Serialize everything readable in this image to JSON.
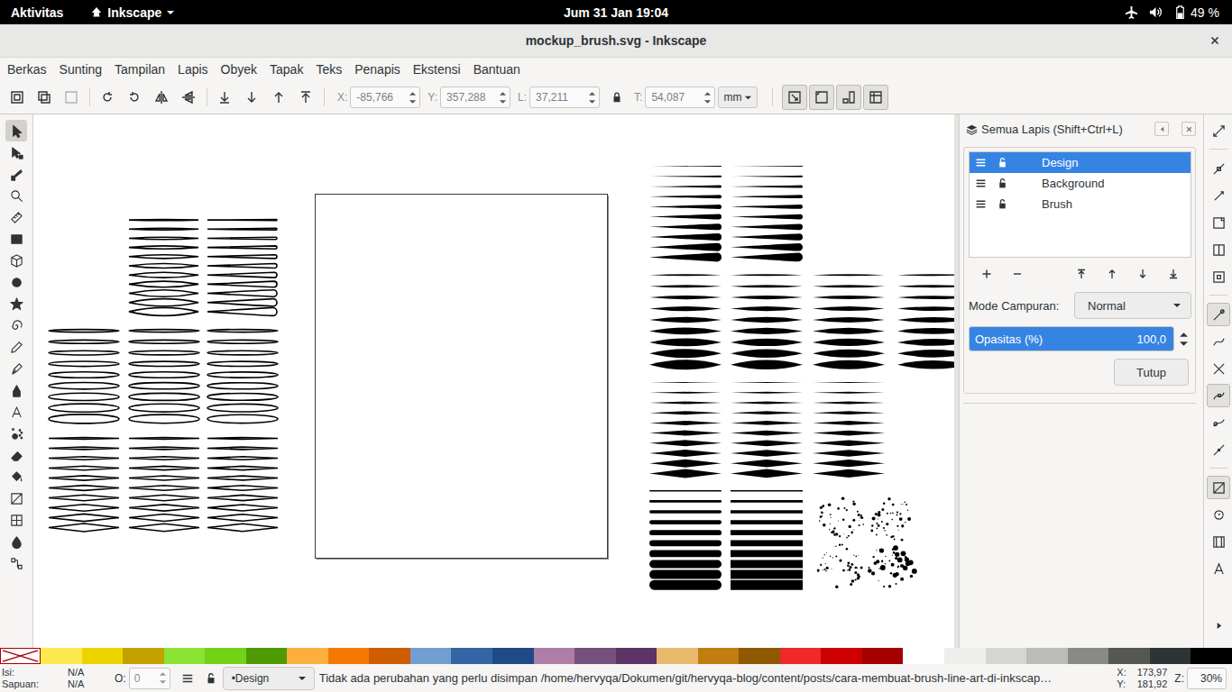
{
  "top_bar": {
    "activities": "Aktivitas",
    "app_name": "Inkscape",
    "clock": "Jum 31 Jan 19:04",
    "battery": "49 %"
  },
  "window": {
    "title": "mockup_brush.svg - Inkscape"
  },
  "menu": [
    "Berkas",
    "Sunting",
    "Tampilan",
    "Lapis",
    "Obyek",
    "Tapak",
    "Teks",
    "Penapis",
    "Ekstensi",
    "Bantuan"
  ],
  "tool_controls": {
    "actions": [
      {
        "disabled": false
      },
      {
        "disabled": false
      },
      {
        "disabled": true
      },
      {
        "disabled": false
      },
      {
        "disabled": false
      },
      {
        "disabled": false
      },
      {
        "disabled": false
      },
      {
        "disabled": false
      },
      {
        "disabled": false
      },
      {
        "disabled": false
      },
      {
        "disabled": false
      }
    ],
    "fields": [
      {
        "label": "X:",
        "value": "-85,766",
        "disabled": true
      },
      {
        "label": "Y:",
        "value": "357,288",
        "disabled": true
      },
      {
        "label": "L:",
        "value": "37,211",
        "disabled": true
      },
      {
        "label": "T:",
        "value": "54,087",
        "disabled": true
      }
    ],
    "unit": "mm",
    "toggles": [
      {
        "on": true
      },
      {
        "on": true
      },
      {
        "on": true
      },
      {
        "on": true
      }
    ]
  },
  "tools": [
    {
      "selected": true
    },
    {
      "selected": false
    },
    {
      "selected": false
    },
    {
      "selected": false
    },
    {
      "selected": false
    },
    {
      "selected": false
    },
    {
      "selected": false
    },
    {
      "selected": false
    },
    {
      "selected": false
    },
    {
      "selected": false
    },
    {
      "selected": false
    },
    {
      "selected": false
    },
    {
      "selected": false
    },
    {
      "selected": false
    },
    {
      "selected": false
    },
    {
      "selected": false
    },
    {
      "selected": false
    },
    {
      "selected": false
    },
    {
      "selected": false
    },
    {
      "selected": false
    },
    {
      "selected": false
    }
  ],
  "layers_panel": {
    "title": "Semua Lapis (Shift+Ctrl+L)",
    "layers": [
      {
        "name": "Design",
        "selected": true,
        "locked": false
      },
      {
        "name": "Background",
        "selected": false,
        "locked": false
      },
      {
        "name": "Brush",
        "selected": false,
        "locked": false
      }
    ],
    "blend_label": "Mode Campuran:",
    "blend_value": "Normal",
    "opacity_label": "Opasitas (%)",
    "opacity_value": "100,0",
    "opacity_level": 1.0,
    "close_button": "Tutup"
  },
  "snap_bar": [
    {
      "on": false
    },
    {
      "on": false
    },
    {
      "on": false
    },
    {
      "on": false
    },
    {
      "on": false
    },
    {
      "on": false
    },
    {
      "on": true
    },
    {
      "on": false
    },
    {
      "on": false
    },
    {
      "on": true
    },
    {
      "on": false
    },
    {
      "on": false
    },
    {
      "on": true
    },
    {
      "on": false
    },
    {
      "on": false
    },
    {
      "on": false
    }
  ],
  "palette": [
    {
      "color": "#fce94f"
    },
    {
      "color": "#edd400"
    },
    {
      "color": "#c4a000"
    },
    {
      "color": "#8ae234"
    },
    {
      "color": "#73d216"
    },
    {
      "color": "#4e9a06"
    },
    {
      "color": "#fcaf3e"
    },
    {
      "color": "#f57900"
    },
    {
      "color": "#ce5c00"
    },
    {
      "color": "#729fcf"
    },
    {
      "color": "#3465a4"
    },
    {
      "color": "#204a87"
    },
    {
      "color": "#ad7fa8"
    },
    {
      "color": "#75507b"
    },
    {
      "color": "#5c3566"
    },
    {
      "color": "#e9b96e"
    },
    {
      "color": "#c17d11"
    },
    {
      "color": "#8f5902"
    },
    {
      "color": "#ef2929"
    },
    {
      "color": "#cc0000"
    },
    {
      "color": "#a40000"
    },
    {
      "color": "#ffffff"
    },
    {
      "color": "#eeeeec"
    },
    {
      "color": "#d3d7cf"
    },
    {
      "color": "#babdb6"
    },
    {
      "color": "#888a85"
    },
    {
      "color": "#555753"
    },
    {
      "color": "#2e3436"
    },
    {
      "color": "#000000"
    }
  ],
  "status_bar": {
    "fill_label": "Isi:",
    "fill_value": "N/A",
    "stroke_label": "Sapuan:",
    "stroke_value": "N/A",
    "opacity_label": "O:",
    "opacity_value": "0",
    "opacity_disabled": true,
    "layer": "•Design",
    "message": "Tidak ada perubahan yang perlu disimpan /home/hervyqa/Dokumen/git/hervyqa-blog/content/posts/cara-membuat-brush-line-art-di-inkscap…",
    "cursor_x_label": "X:",
    "cursor_x": "173,97",
    "cursor_y_label": "Y:",
    "cursor_y": "181,92",
    "zoom_label": "Z:",
    "zoom": "30%"
  }
}
